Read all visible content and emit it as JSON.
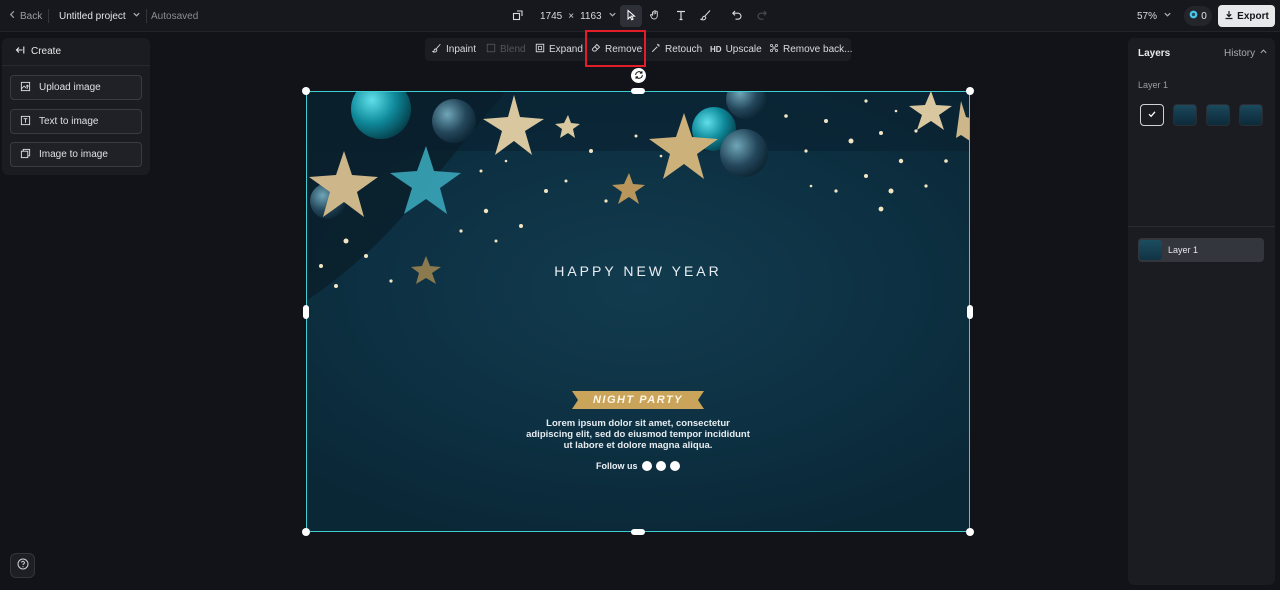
{
  "topbar": {
    "back_label": "Back",
    "project_name": "Untitled project",
    "autosave_status": "Autosaved",
    "canvas_width": "1745",
    "times": "×",
    "canvas_height": "1163",
    "zoom_level": "57%",
    "credits": "0",
    "export_label": "Export"
  },
  "left_panel": {
    "title": "Create",
    "buttons": [
      {
        "label": "Upload image"
      },
      {
        "label": "Text to image"
      },
      {
        "label": "Image to image"
      }
    ]
  },
  "edit_toolbar": {
    "items": [
      {
        "label": "Inpaint"
      },
      {
        "label": "Blend"
      },
      {
        "label": "Expand"
      },
      {
        "label": "Remove"
      },
      {
        "label": "Retouch"
      },
      {
        "label": "Upscale",
        "badge": "HD"
      },
      {
        "label": "Remove back..."
      }
    ]
  },
  "canvas_image": {
    "heading": "HAPPY NEW YEAR",
    "ribbon": "NIGHT PARTY",
    "body_lines": [
      "Lorem ipsum dolor sit amet, consectetur",
      "adipiscing elit, sed do eiusmod tempor incididunt",
      "ut labore et dolore magna aliqua."
    ],
    "follow_label": "Follow us"
  },
  "right_panel": {
    "title": "Layers",
    "history_label": "History",
    "section_label": "Layer 1",
    "layer_items": [
      {
        "name": "Layer 1"
      }
    ]
  },
  "colors": {
    "selection": "#3ecdd0",
    "highlight": "#e11d2a",
    "gold": "#c9a45a",
    "teal": "#1e8fa0"
  }
}
